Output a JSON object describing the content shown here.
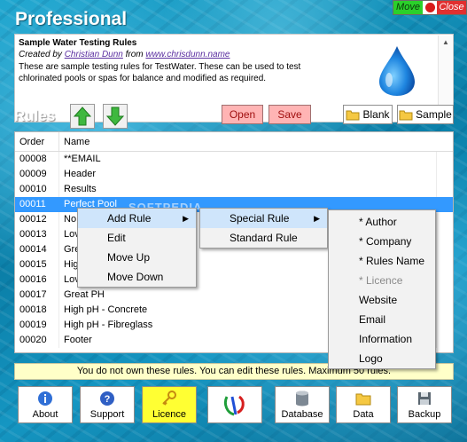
{
  "app": {
    "title": "Professional"
  },
  "window_controls": {
    "move_label": "Move",
    "close_label": "Close"
  },
  "info": {
    "title": "Sample Water Testing Rules",
    "created_by_prefix": "Created by",
    "author": "Christian Dunn",
    "from_word": "from",
    "website": "www.chrisdunn.name",
    "description": "These are sample testing rules for TestWater. These can be used to test chlorinated pools or spas for balance and modified as required."
  },
  "rules": {
    "heading": "Rules",
    "buttons": {
      "open": "Open",
      "save": "Save",
      "blank": "Blank",
      "sample": "Sample"
    },
    "columns": [
      "Order",
      "Name"
    ],
    "rows": [
      {
        "order": "00008",
        "name": "**EMAIL"
      },
      {
        "order": "00009",
        "name": "Header"
      },
      {
        "order": "00010",
        "name": "Results"
      },
      {
        "order": "00011",
        "name": "Perfect Pool",
        "selected": true
      },
      {
        "order": "00012",
        "name": "No"
      },
      {
        "order": "00013",
        "name": "Lov"
      },
      {
        "order": "00014",
        "name": "Gre"
      },
      {
        "order": "00015",
        "name": "Hig"
      },
      {
        "order": "00016",
        "name": "Lov"
      },
      {
        "order": "00017",
        "name": "Great PH"
      },
      {
        "order": "00018",
        "name": "High pH - Concrete"
      },
      {
        "order": "00019",
        "name": "High pH - Fibreglass"
      },
      {
        "order": "00020",
        "name": "Footer"
      }
    ]
  },
  "context_menu": {
    "items": [
      "Add Rule",
      "Edit",
      "Move Up",
      "Move Down"
    ],
    "special_menu": [
      "Special Rule",
      "Standard Rule"
    ],
    "fields_menu": [
      "* Author",
      "* Company",
      "* Rules Name",
      "* Licence",
      "Website",
      "Email",
      "Information",
      "Logo"
    ]
  },
  "status": {
    "message": "You do not own these rules. You can edit these rules. Maximum 50 rules."
  },
  "toolbar": {
    "about": "About",
    "support": "Support",
    "licence": "Licence",
    "database": "Database",
    "data": "Data",
    "backup": "Backup"
  },
  "watermark": "SOFTPEDIA",
  "colors": {
    "accent": "#3399ff",
    "licence_bg": "#ffff33",
    "pink_button": "#ffb4b4",
    "status_bg": "#ffffc8"
  }
}
